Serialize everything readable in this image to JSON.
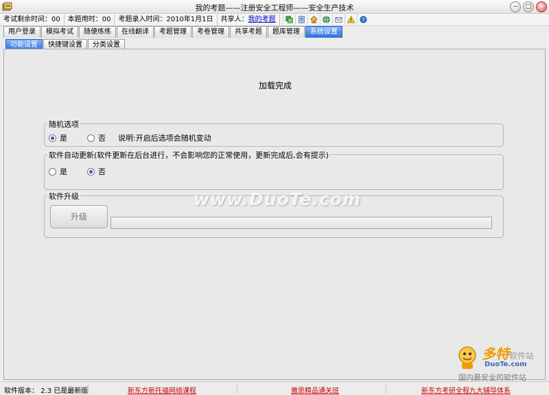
{
  "window": {
    "title": "我的考题——注册安全工程师——安全生产技术",
    "min_glyph": "−",
    "max_glyph": "□",
    "close_glyph": "×"
  },
  "infobar": {
    "remaining_label": "考试剩余时间：",
    "remaining_value": "00",
    "used_label": "本题用时：",
    "used_value": "00",
    "entry_label": "考题录入时间：",
    "entry_value": "2010年1月1日",
    "sharer_label": "共享人：",
    "sharer_link": "我的考题",
    "tool_icons": [
      "copy-icon",
      "document-icon",
      "home-icon",
      "globe-icon",
      "mail-icon",
      "warning-icon",
      "help-icon"
    ]
  },
  "tabs": [
    {
      "label": "用户登录",
      "active": false
    },
    {
      "label": "模拟考试",
      "active": false
    },
    {
      "label": "随便练练",
      "active": false
    },
    {
      "label": "在线翻译",
      "active": false
    },
    {
      "label": "考题管理",
      "active": false
    },
    {
      "label": "考卷管理",
      "active": false
    },
    {
      "label": "共享考题",
      "active": false
    },
    {
      "label": "题库管理",
      "active": false
    },
    {
      "label": "系统设置",
      "active": true
    }
  ],
  "subtabs": [
    {
      "label": "功能设置",
      "active": true
    },
    {
      "label": "快捷键设置",
      "active": false
    },
    {
      "label": "分类设置",
      "active": false
    }
  ],
  "main": {
    "status_text": "加载完成",
    "random_group": {
      "legend": "随机选项",
      "yes_label": "是",
      "no_label": "否",
      "selected": "yes",
      "note": "说明:开启后选项会随机变动"
    },
    "update_group": {
      "legend": "软件自动更新(软件更新在后台进行，不会影响您的正常使用，更新完成后,会有提示)",
      "yes_label": "是",
      "no_label": "否",
      "selected": "no"
    },
    "upgrade_group": {
      "legend": "软件升级",
      "button_label": "升级",
      "progress": 0
    }
  },
  "watermark": {
    "text": "www.DuoTe.com",
    "logo_title": "多特",
    "logo_tail": "软件站",
    "logo_site": "DuoTe.com",
    "logo_slogan": "国内最安全的软件站"
  },
  "statusbar": {
    "version_label": "软件版本：",
    "version_value": "2.3",
    "version_status": "已是最新版",
    "links": [
      "新东方新托福网络课程",
      "雅思精品通关班",
      "新东方考研全程九大辅导体系"
    ]
  },
  "colors": {
    "active_tab": "#2f6fd6",
    "link": "#0000cc",
    "status_link": "#cc0000",
    "logo_orange": "#f29a00"
  }
}
